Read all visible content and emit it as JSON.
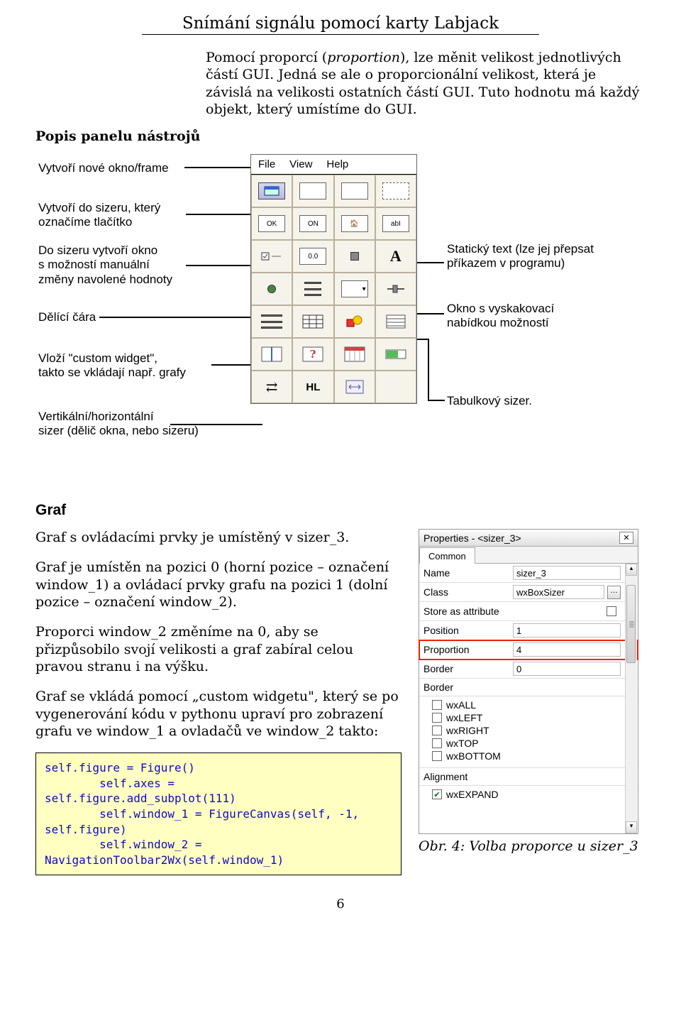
{
  "page": {
    "title_underlined": "Snímání signálu pomocí karty Labjack",
    "num": "6"
  },
  "intro": {
    "label": "Popis panelu nástrojů",
    "p1a": "Pomocí proporcí (",
    "p1i": "proportion",
    "p1b": "), lze měnit velikost jednotlivých částí GUI. Jedná se ale o proporcionální velikost, která je závislá na velikosti ostatních částí GUI. Tuto hodnotu má každý objekt, který umístíme do GUI."
  },
  "diagram": {
    "menu": {
      "file": "File",
      "view": "View",
      "help": "Help"
    },
    "icons": {
      "frame": "▭",
      "ok": "OK",
      "on": "ON",
      "abi": "abI",
      "spin": "0.0",
      "bigA": "A",
      "hl": "HL",
      "customq": "?",
      "arrow": "⇄"
    },
    "left": {
      "a": "Vytvoří nové okno/frame",
      "b": "Vytvoří do sizeru, který\noznačíme tlačítko",
      "c": "Do sizeru vytvoří okno\ns možností manuální\nzměny navolené hodnoty",
      "d": "Dělící čára",
      "e": "Vloží \"custom widget\",\ntakto se vkládají např. grafy",
      "f": "Vertikální/horizontální\nsizer (dělič okna, nebo sizeru)"
    },
    "right": {
      "a": "Statický text (lze jej přepsat\npříkazem v programu)",
      "b": "Okno s vyskakovací\nnabídkou možností",
      "c": "Tabulkový sizer."
    }
  },
  "graf": {
    "heading": "Graf",
    "p1": "Graf s ovládacími prvky je umístěný v sizer_3.",
    "p2": "Graf je umístěn na pozici 0 (horní pozice – označení window_1) a ovládací prvky grafu na pozici 1 (dolní pozice – označení window_2).",
    "p3": "Proporci window_2 změníme na 0, aby se přizpůsobilo svojí velikosti a graf zabíral celou pravou stranu i na výšku.",
    "p4": "Graf se vkládá pomocí „custom widgetu\", který se po vygenerování kódu v pythonu upraví pro zobrazení grafu ve window_1 a ovladačů ve window_2 takto:",
    "code": "self.figure = Figure()\n        self.axes =\nself.figure.add_subplot(111)\n        self.window_1 = FigureCanvas(self, -1,\nself.figure)\n        self.window_2 =\nNavigationToolbar2Wx(self.window_1)",
    "caption": "Obr. 4: Volba proporce u sizer_3"
  },
  "props": {
    "title": "Properties - <sizer_3>",
    "tab": "Common",
    "rows": {
      "name": {
        "label": "Name",
        "value": "sizer_3"
      },
      "class": {
        "label": "Class",
        "value": "wxBoxSizer"
      },
      "store": {
        "label": "Store as attribute"
      },
      "position": {
        "label": "Position",
        "value": "1"
      },
      "proportion": {
        "label": "Proportion",
        "value": "4"
      },
      "border": {
        "label": "Border",
        "value": "0"
      }
    },
    "border_section": "Border",
    "flags": [
      "wxALL",
      "wxLEFT",
      "wxRIGHT",
      "wxTOP",
      "wxBOTTOM"
    ],
    "alignment_label": "Alignment",
    "expand": "wxEXPAND"
  }
}
